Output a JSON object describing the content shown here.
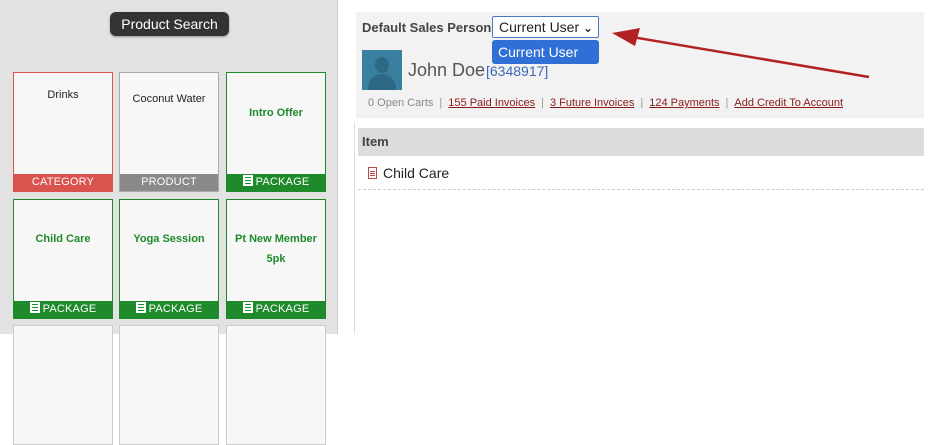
{
  "product_search": {
    "label": "Product Search"
  },
  "tiles": [
    {
      "name": "Drinks",
      "type_label": "CATEGORY",
      "kind": "category"
    },
    {
      "name": "Coconut Water",
      "type_label": "PRODUCT",
      "kind": "product"
    },
    {
      "name": "Intro Offer",
      "type_label": "PACKAGE",
      "kind": "package"
    },
    {
      "name": "Child Care",
      "type_label": "PACKAGE",
      "kind": "package"
    },
    {
      "name": "Yoga Session",
      "type_label": "PACKAGE",
      "kind": "package"
    },
    {
      "name": "Pt New Member 5pk",
      "type_label": "PACKAGE",
      "kind": "package"
    }
  ],
  "sales_person": {
    "label": "Default Sales Person:",
    "selected": "Current User",
    "options": [
      "Current User"
    ]
  },
  "customer": {
    "name": "John Doe",
    "id": "[6348917]"
  },
  "links": {
    "open_carts": "0 Open Carts",
    "paid_invoices": "155 Paid Invoices",
    "future_invoices": "3 Future Invoices",
    "payments": "124 Payments",
    "add_credit": "Add Credit To Account"
  },
  "items_table": {
    "header": "Item",
    "rows": [
      {
        "label": "Child Care"
      }
    ]
  },
  "colors": {
    "category": "#d9534f",
    "product": "#8a8a8a",
    "package": "#1f8a2b",
    "annotation_arrow": "#b22222",
    "select_highlight": "#2f6fd6"
  }
}
